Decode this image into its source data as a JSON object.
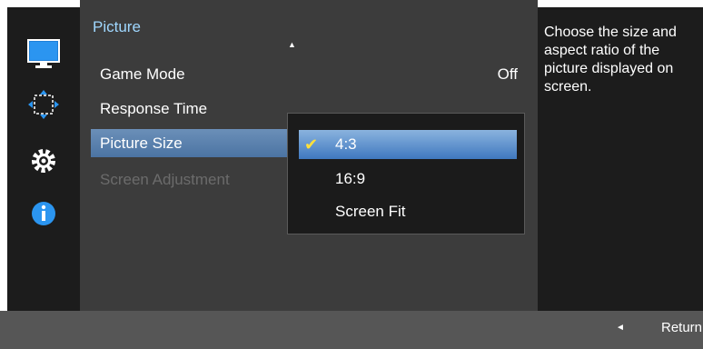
{
  "sidebar": {
    "icons": [
      "monitor-icon",
      "move-arrows-icon",
      "gear-icon",
      "info-icon"
    ]
  },
  "menu": {
    "title": "Picture",
    "items": [
      {
        "label": "Game Mode",
        "value": "Off",
        "state": "normal"
      },
      {
        "label": "Response Time",
        "state": "normal"
      },
      {
        "label": "Picture Size",
        "state": "selected"
      },
      {
        "label": "Screen Adjustment",
        "state": "disabled"
      }
    ]
  },
  "submenu": {
    "options": [
      {
        "label": "4:3",
        "checked": true
      },
      {
        "label": "16:9",
        "checked": false
      },
      {
        "label": "Screen Fit",
        "checked": false
      }
    ]
  },
  "help": {
    "text": "Choose the size and aspect ratio of the picture displayed on screen."
  },
  "footer": {
    "return_label": "Return"
  },
  "colors": {
    "title": "#9fd7ff",
    "selected_bar": "#4c74a3",
    "submenu_selected": "#3f78bf",
    "checkmark": "#ffe03a",
    "disabled_text": "#6b6b6b"
  }
}
